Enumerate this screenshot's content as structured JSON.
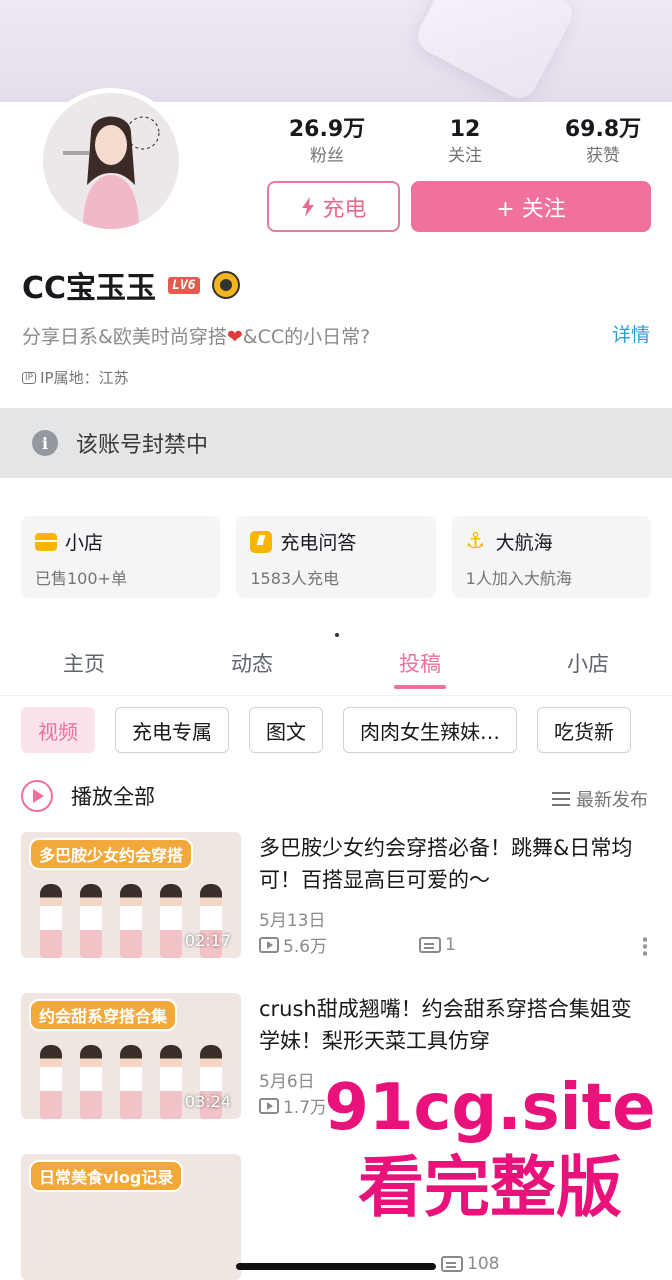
{
  "profile": {
    "name": "CC宝玉玉",
    "level": "LV6",
    "bio_before": "分享日系&欧美时尚穿搭",
    "bio_after": "&CC的小日常?",
    "detail_link": "详情",
    "ip_label": "IP属地：江苏",
    "ip_tag": "IP"
  },
  "stats": [
    {
      "value": "26.9万",
      "label": "粉丝"
    },
    {
      "value": "12",
      "label": "关注"
    },
    {
      "value": "69.8万",
      "label": "获赞"
    }
  ],
  "buttons": {
    "charge": "充电",
    "follow": "+ 关注"
  },
  "notice": {
    "text": "该账号封禁中"
  },
  "cards": [
    {
      "title": "小店",
      "sub": "已售100+单",
      "icon": "shop-icon"
    },
    {
      "title": "充电问答",
      "sub": "1583人充电",
      "icon": "qa-icon"
    },
    {
      "title": "大航海",
      "sub": "1人加入大航海",
      "icon": "anchor-icon"
    }
  ],
  "tabs": [
    {
      "label": "主页",
      "active": false
    },
    {
      "label": "动态",
      "active": false
    },
    {
      "label": "投稿",
      "active": true
    },
    {
      "label": "小店",
      "active": false
    }
  ],
  "chips": [
    "视频",
    "充电专属",
    "图文",
    "肉肉女生辣妹…",
    "吃货新"
  ],
  "playall": {
    "label": "播放全部",
    "sort": "最新发布"
  },
  "videos": [
    {
      "caption": "多巴胺少女约会穿搭",
      "duration": "02:17",
      "title": "多巴胺少女约会穿搭必备！跳舞&日常均可！百搭显高巨可爱的～",
      "date": "5月13日",
      "views": "5.6万",
      "comments": "1"
    },
    {
      "caption": "约会甜系穿搭合集",
      "duration": "03:24",
      "title": "crush甜成翘嘴！约会甜系穿搭合集姐变学妹！梨形天菜工具仿穿",
      "date": "5月6日",
      "views": "1.7万",
      "comments": ""
    },
    {
      "caption": "日常美食vlog记录",
      "duration": "",
      "title": "",
      "date": "",
      "views": "",
      "comments": "108"
    }
  ],
  "watermark": {
    "line1": "91cg.site",
    "line2": "看完整版"
  },
  "colors": {
    "accent": "#f0719a",
    "link": "#2a9fd6",
    "gold": "#f7b500"
  }
}
